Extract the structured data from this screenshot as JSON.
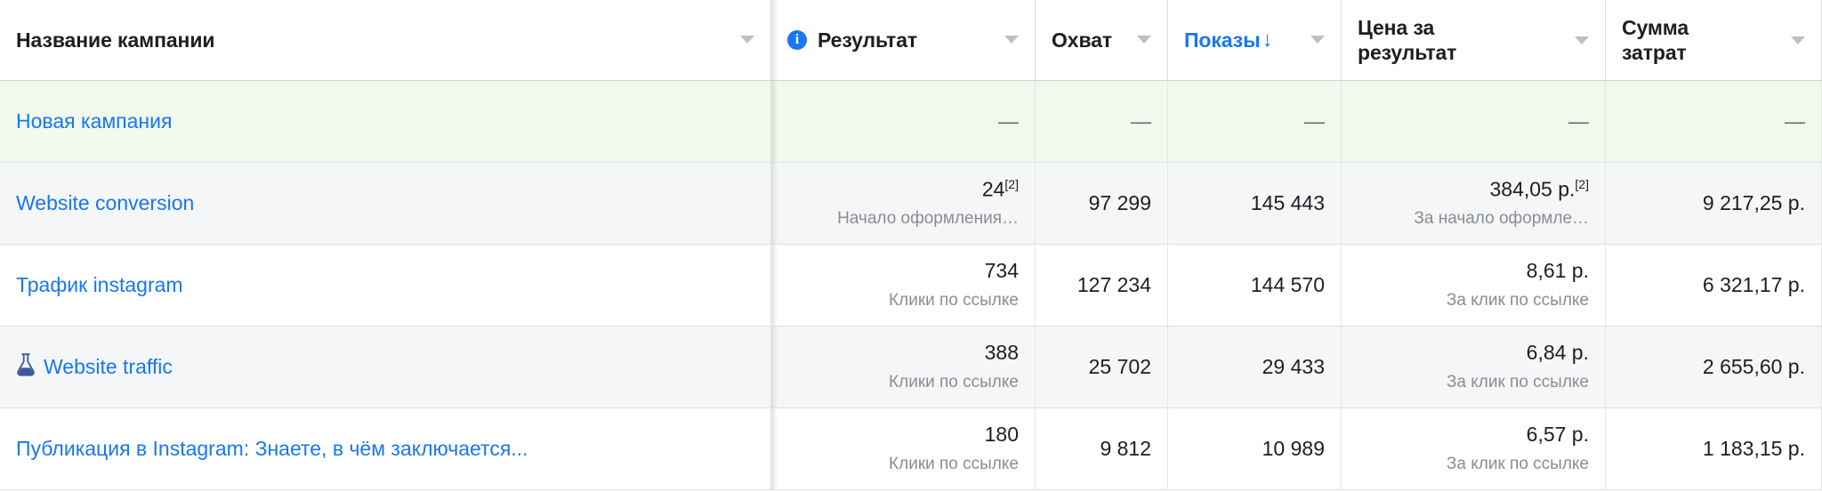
{
  "table": {
    "columns": [
      {
        "key": "name",
        "label": "Название кампании",
        "align": "left",
        "has_info_icon": false,
        "sorted": false,
        "has_caret": true
      },
      {
        "key": "result",
        "label": "Результат",
        "align": "left",
        "has_info_icon": true,
        "sorted": false,
        "has_caret": true
      },
      {
        "key": "reach",
        "label": "Охват",
        "align": "left",
        "has_info_icon": false,
        "sorted": false,
        "has_caret": true
      },
      {
        "key": "impressions",
        "label": "Показы",
        "align": "left",
        "has_info_icon": false,
        "sorted": true,
        "sort_direction": "↓",
        "has_caret": true
      },
      {
        "key": "cost_per_result",
        "label": "Цена за\nрезультат",
        "align": "left",
        "has_info_icon": false,
        "sorted": false,
        "has_caret": true
      },
      {
        "key": "amount_spent",
        "label": "Сумма\nзатрат",
        "align": "left",
        "has_info_icon": false,
        "sorted": false,
        "has_caret": true
      }
    ],
    "rows": [
      {
        "name": "Новая кампания",
        "icon": null,
        "highlight": "green",
        "result": "—",
        "result_sub": "",
        "result_sup": "",
        "reach": "—",
        "impressions": "—",
        "cost_per_result": "—",
        "cost_per_result_sub": "",
        "cost_per_result_sup": "",
        "amount_spent": "—"
      },
      {
        "name": "Website conversion",
        "icon": null,
        "highlight": "grey",
        "result": "24",
        "result_sup": "[2]",
        "result_sub": "Начало оформления…",
        "reach": "97 299",
        "impressions": "145 443",
        "cost_per_result": "384,05 р.",
        "cost_per_result_sup": "[2]",
        "cost_per_result_sub": "За начало оформле…",
        "amount_spent": "9 217,25 р."
      },
      {
        "name": "Трафик instagram",
        "icon": null,
        "highlight": "white",
        "result": "734",
        "result_sup": "",
        "result_sub": "Клики по ссылке",
        "reach": "127 234",
        "impressions": "144 570",
        "cost_per_result": "8,61 р.",
        "cost_per_result_sup": "",
        "cost_per_result_sub": "За клик по ссылке",
        "amount_spent": "6 321,17 р."
      },
      {
        "name": "Website traffic",
        "icon": "flask-icon",
        "highlight": "grey",
        "result": "388",
        "result_sup": "",
        "result_sub": "Клики по ссылке",
        "reach": "25 702",
        "impressions": "29 433",
        "cost_per_result": "6,84 р.",
        "cost_per_result_sup": "",
        "cost_per_result_sub": "За клик по ссылке",
        "amount_spent": "2 655,60 р."
      },
      {
        "name": "Публикация в Instagram: Знаете, в чём заключается...",
        "icon": null,
        "highlight": "white",
        "result": "180",
        "result_sup": "",
        "result_sub": "Клики по ссылке",
        "reach": "9 812",
        "impressions": "10 989",
        "cost_per_result": "6,57 р.",
        "cost_per_result_sup": "",
        "cost_per_result_sub": "За клик по ссылке",
        "amount_spent": "1 183,15 р."
      }
    ]
  },
  "colors": {
    "link": "#1877f2",
    "accent": "#1877f2",
    "row_highlight_green": "#f1f8ec",
    "row_highlight_grey": "#f5f6f7",
    "text_primary": "#1c1e21",
    "text_secondary": "#8a8d91",
    "border": "#dddfe2"
  },
  "icons": {
    "info": "i",
    "sort_desc": "↓",
    "caret_down": "▾"
  }
}
